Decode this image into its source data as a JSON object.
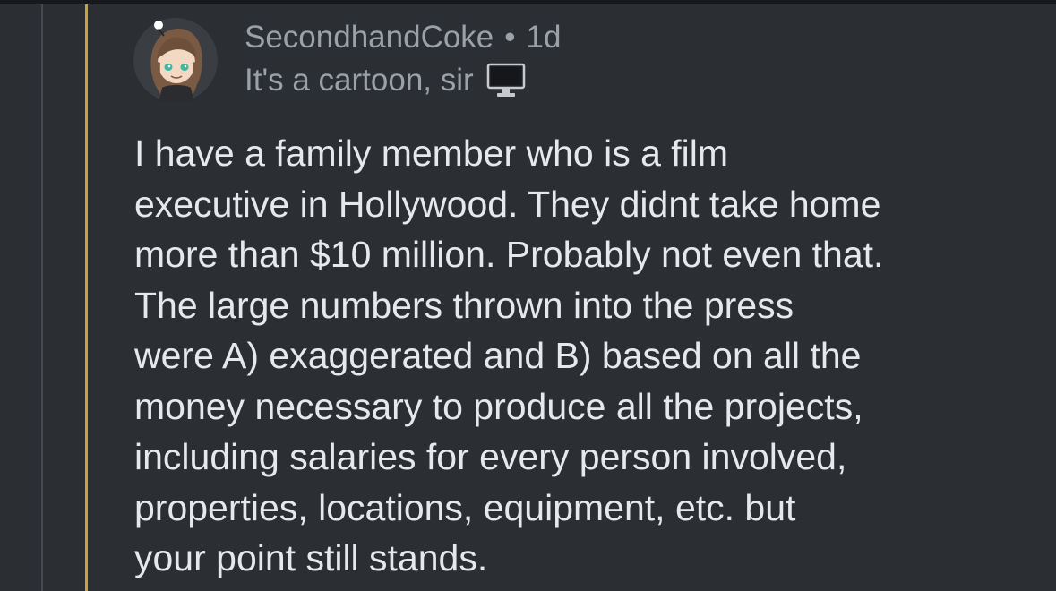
{
  "comment": {
    "author": "SecondhandCoke",
    "separator": "•",
    "age": "1d",
    "flair_text": "It's a cartoon, sir",
    "flair_icon": "computer-monitor-icon",
    "body": "I have a family member who is a film\nexecutive in Hollywood. They didnt take home\nmore than $10 million. Probably not even that.\nThe large numbers thrown into the press\nwere A) exaggerated and B) based on all the\nmoney necessary to produce all the projects,\nincluding salaries for every person involved,\nproperties, locations, equipment, etc. but\nyour point still stands."
  },
  "colors": {
    "background": "#2b2e33",
    "thread_line_active": "#c9a23a",
    "thread_line_inactive": "#474b51",
    "meta_text": "#9ba1a8",
    "body_text": "#e6e8eb"
  }
}
